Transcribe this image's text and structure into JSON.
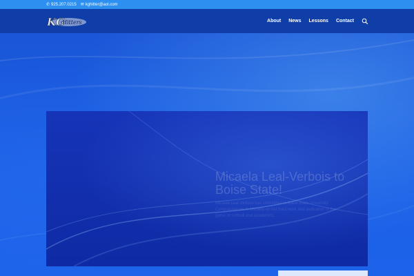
{
  "topbar": {
    "phone": "925.207.0215",
    "email": "kghitter@aol.com"
  },
  "header": {
    "logo_text": "KG",
    "logo_script": "Hitters",
    "nav": [
      "About",
      "News",
      "Lessons",
      "Contact"
    ]
  },
  "slide": {
    "title": "Micaela Leal-Verbois to Boise State!",
    "text": "Micaela Leal-Verbois has committed to Boise State University. Congratulations to Micaela on her hard work and dedication to the game of softball and academics."
  },
  "icons": {
    "phone": "phone-icon",
    "email": "envelope-icon",
    "search": "search-icon"
  }
}
